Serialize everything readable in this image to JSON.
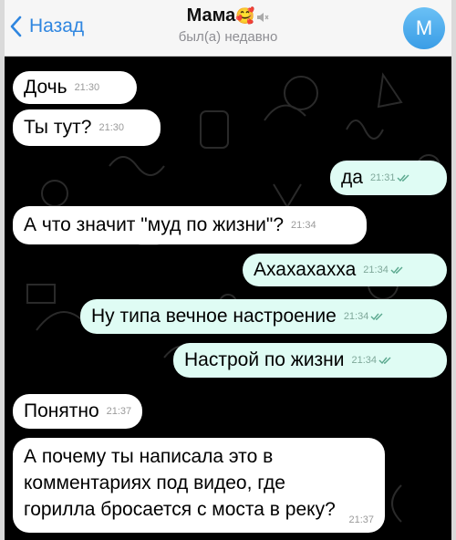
{
  "header": {
    "back_label": "Назад",
    "title": "Мама",
    "title_emoji": "🥰",
    "subtitle": "был(а) недавно",
    "avatar_letter": "М",
    "accent": "#2f86e0"
  },
  "colors": {
    "incoming_bubble": "#ffffff",
    "outgoing_bubble": "#dffcf4",
    "background": "#000000"
  },
  "messages": [
    {
      "side": "in",
      "text": "Дочь",
      "time": "21:30"
    },
    {
      "side": "in",
      "text": "Ты тут?",
      "time": "21:30"
    },
    {
      "side": "out",
      "text": "да",
      "time": "21:31",
      "read": true
    },
    {
      "side": "in",
      "text": "А что значит \"муд по жизни\"?",
      "time": "21:34"
    },
    {
      "side": "out",
      "text": "Ахахахахха",
      "time": "21:34",
      "read": true
    },
    {
      "side": "out",
      "text": "Ну типа вечное настроение",
      "time": "21:34",
      "read": true
    },
    {
      "side": "out",
      "text": "Настрой по жизни",
      "time": "21:34",
      "read": true
    },
    {
      "side": "in",
      "text": "Понятно",
      "time": "21:37"
    },
    {
      "side": "in",
      "lines": [
        "А почему ты написала это в",
        "комментариях под видео, где",
        "горилла бросается с моста в реку?"
      ],
      "time": "21:37"
    }
  ]
}
